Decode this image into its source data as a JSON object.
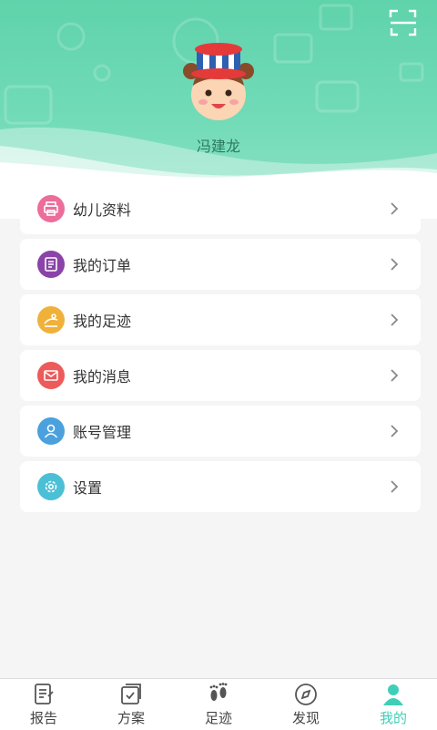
{
  "profile": {
    "username": "冯建龙"
  },
  "menu": {
    "items": [
      {
        "label": "幼儿资料",
        "icon": "printer-icon",
        "color": "#ec6d9b"
      },
      {
        "label": "我的订单",
        "icon": "order-list-icon",
        "color": "#8a43a8"
      },
      {
        "label": "我的足迹",
        "icon": "picture-icon",
        "color": "#f0b13b"
      },
      {
        "label": "我的消息",
        "icon": "mail-icon",
        "color": "#ec5a5a"
      },
      {
        "label": "账号管理",
        "icon": "user-icon",
        "color": "#4aa1dd"
      },
      {
        "label": "设置",
        "icon": "gear-icon",
        "color": "#4bbfd6"
      }
    ]
  },
  "tabbar": {
    "items": [
      {
        "label": "报告",
        "icon": "report-icon"
      },
      {
        "label": "方案",
        "icon": "plan-icon"
      },
      {
        "label": "足迹",
        "icon": "footprint-icon"
      },
      {
        "label": "发现",
        "icon": "discover-icon"
      },
      {
        "label": "我的",
        "icon": "mine-icon",
        "active": true
      }
    ]
  },
  "colors": {
    "header": "#5fd3ab",
    "accent": "#3fcfb8",
    "background": "#f5f5f5"
  }
}
